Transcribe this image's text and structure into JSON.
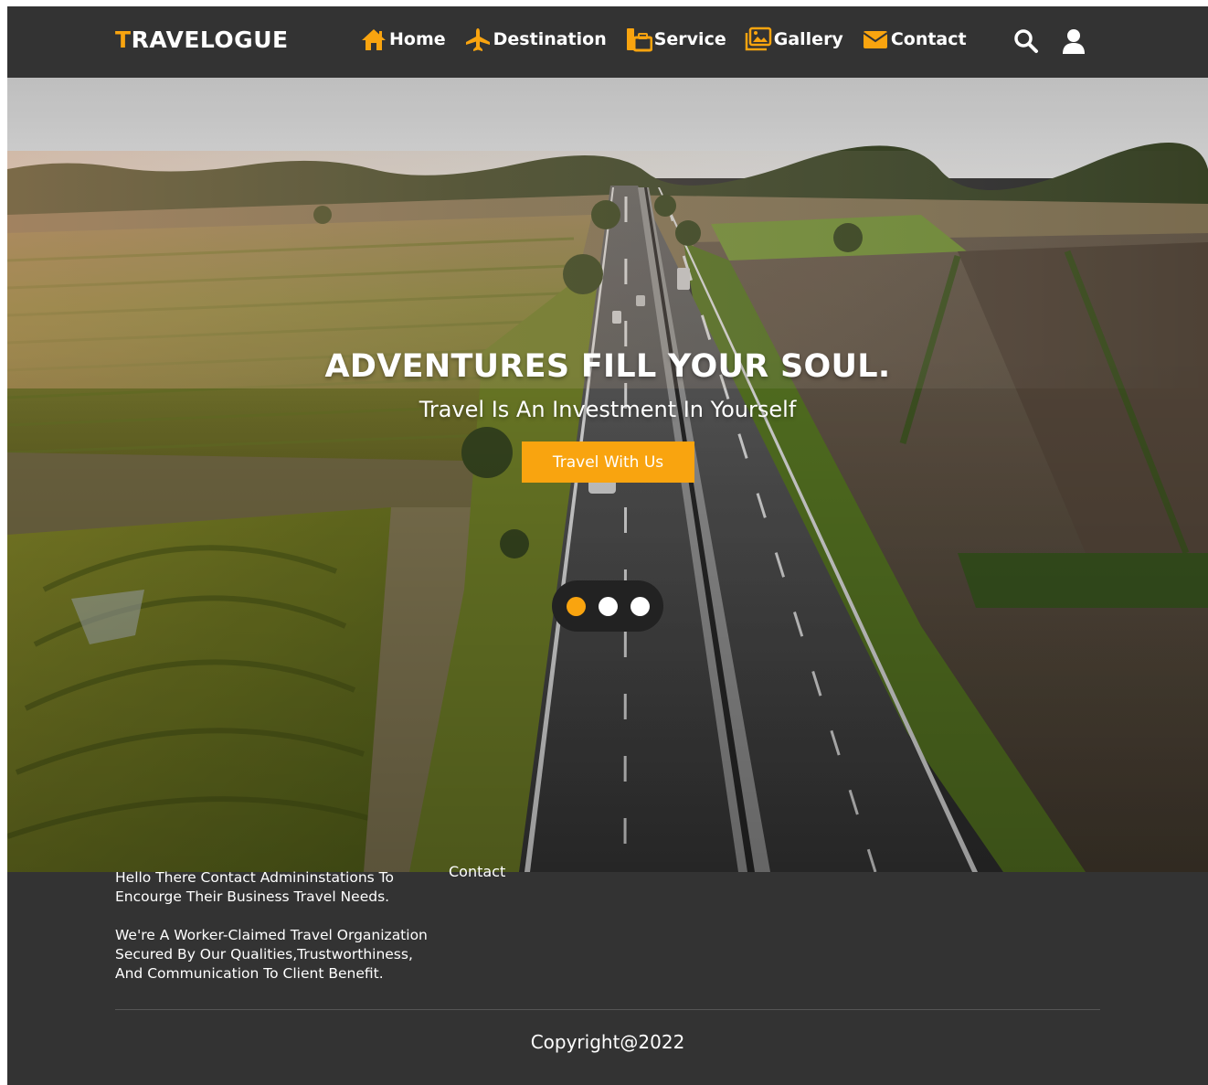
{
  "theme": {
    "accent": "#f9a40f",
    "dark": "#333333"
  },
  "brand": {
    "first_letter": "T",
    "rest": "RAVELOGUE"
  },
  "nav": {
    "items": [
      {
        "label": "Home",
        "icon": "home-icon"
      },
      {
        "label": "Destination",
        "icon": "plane-icon"
      },
      {
        "label": "Service",
        "icon": "suitcase-icon"
      },
      {
        "label": "Gallery",
        "icon": "image-icon"
      },
      {
        "label": "Contact",
        "icon": "envelope-icon"
      }
    ],
    "right_icons": [
      "search-icon",
      "user-icon"
    ]
  },
  "hero": {
    "title": "ADVENTURES FILL YOUR SOUL.",
    "subtitle": "Travel Is An Investment In Yourself",
    "cta_label": "Travel With Us",
    "slider": {
      "count": 3,
      "active": 0
    }
  },
  "footer": {
    "cut_label": "Contact",
    "paragraph1": "Hello There Contact Admininstations To Encourge Their Business Travel Needs.",
    "paragraph2": "We're A Worker-Claimed Travel Organization Secured By Our Qualities,Trustworthiness, And Communication To Client Benefit.",
    "copyright": "Copyright@2022"
  }
}
